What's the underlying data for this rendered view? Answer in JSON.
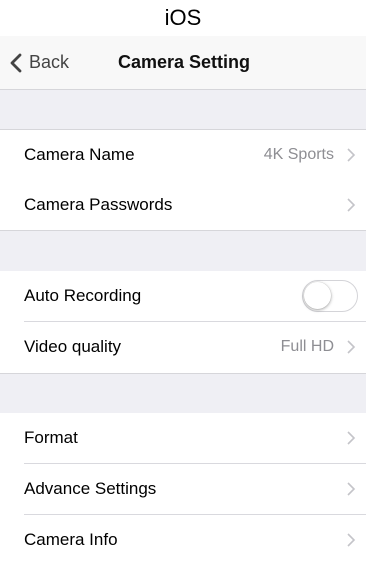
{
  "caption": "iOS",
  "nav": {
    "back_label": "Back",
    "title": "Camera Setting"
  },
  "sections": [
    {
      "rows": [
        {
          "label": "Camera Name",
          "value": "4K Sports"
        },
        {
          "label": "Camera Passwords"
        }
      ]
    },
    {
      "rows": [
        {
          "label": "Auto Recording",
          "toggle_on": false
        },
        {
          "label": "Video quality",
          "value": "Full HD"
        }
      ]
    },
    {
      "rows": [
        {
          "label": "Format"
        },
        {
          "label": "Advance Settings"
        },
        {
          "label": "Camera Info"
        }
      ]
    }
  ],
  "icons": {
    "back": "chevron-left-icon",
    "disclosure": "chevron-right-icon"
  },
  "colors": {
    "nav_bg": "#f8f8f8",
    "group_bg": "#efeff4",
    "value_text": "#8e8e93",
    "separator": "#d9d9de"
  }
}
